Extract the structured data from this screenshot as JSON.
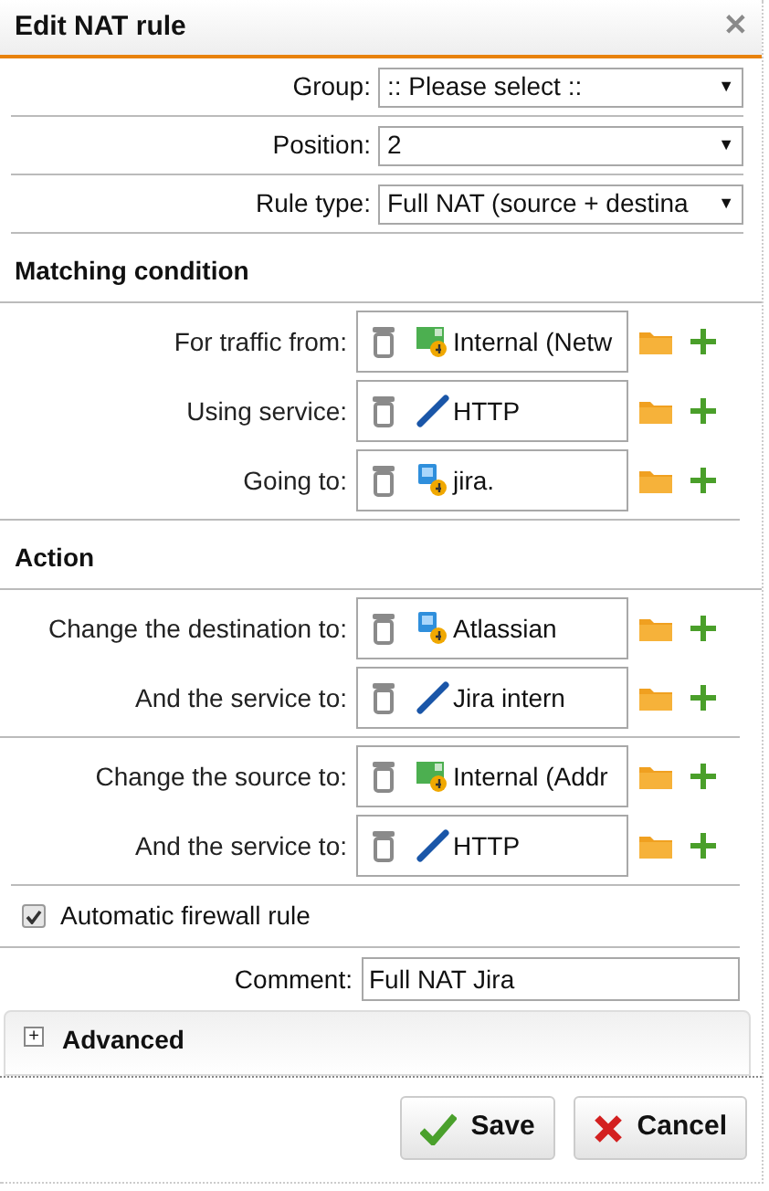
{
  "window": {
    "title": "Edit NAT rule",
    "close": "✕"
  },
  "selects": [
    {
      "label": "Group:",
      "value": ":: Please select ::",
      "arrow": "▼"
    },
    {
      "label": "Position:",
      "value": "2",
      "arrow": "▼"
    },
    {
      "label": "Rule type:",
      "value": "Full NAT (source + destina",
      "arrow": "▼"
    }
  ],
  "matching": {
    "title": "Matching condition",
    "groups": [
      [
        {
          "label": "For traffic from:",
          "value": "Internal (Netw",
          "kind": "network"
        },
        {
          "label": "Using service:",
          "value": "HTTP",
          "kind": "service"
        },
        {
          "label": "Going to:",
          "value": "jira.",
          "kind": "host"
        }
      ]
    ]
  },
  "action": {
    "title": "Action",
    "groups": [
      [
        {
          "label": "Change the destination to:",
          "value": "Atlassian",
          "kind": "host"
        },
        {
          "label": "And the service to:",
          "value": "Jira intern",
          "kind": "service"
        }
      ],
      [
        {
          "label": "Change the source to:",
          "value": "Internal (Addr",
          "kind": "network"
        },
        {
          "label": "And the service to:",
          "value": "HTTP",
          "kind": "service"
        }
      ]
    ]
  },
  "firewall": {
    "label": "Automatic firewall rule",
    "checked": true
  },
  "comment": {
    "label": "Comment:",
    "value": "Full NAT Jira"
  },
  "advanced": {
    "label": "Advanced",
    "expanded": false,
    "toggle": "+"
  },
  "buttons": [
    {
      "label": "Save",
      "kind": "save"
    },
    {
      "label": "Cancel",
      "kind": "cancel"
    }
  ]
}
